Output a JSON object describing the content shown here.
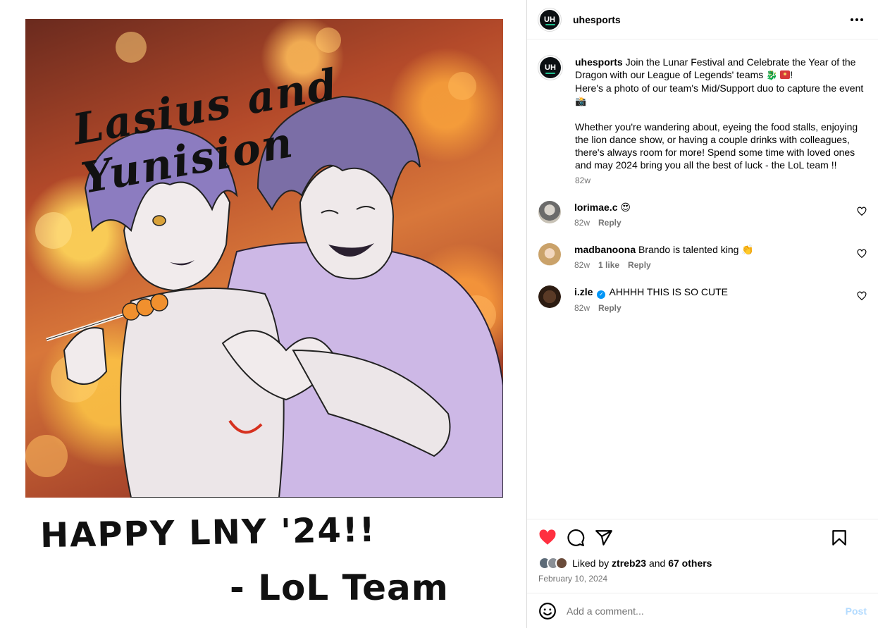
{
  "post": {
    "account": "uhesports",
    "avatar_text": "UH",
    "art": {
      "title": "Lasius and Yunision",
      "greeting": "HAPPY LNY '24!!",
      "signature": "- LoL Team"
    },
    "caption": {
      "username": "uhesports",
      "line1": "Join the Lunar Festival and Celebrate the Year of the Dragon with our League of Legends' teams",
      "emoji1": "🐉",
      "after_emoji": "!",
      "line2": "Here's a photo of our team's Mid/Support duo to capture the event",
      "emoji2": "📸",
      "paragraph2": "Whether you're wandering about, eyeing the food stalls, enjoying the lion dance show, or having a couple drinks with colleagues, there's always room for more! Spend some time with loved ones and may 2024 bring you all the best of luck - the LoL team !!",
      "time": "82w"
    },
    "comments": [
      {
        "username": "lorimae.c",
        "text": "😍",
        "time": "82w",
        "likes": "",
        "reply": "Reply",
        "verified": false
      },
      {
        "username": "madbanoona",
        "text": "Brando is talented king 👏",
        "time": "82w",
        "likes": "1 like",
        "reply": "Reply",
        "verified": false
      },
      {
        "username": "i.zle",
        "text": "AHHHH THIS IS SO CUTE",
        "time": "82w",
        "likes": "",
        "reply": "Reply",
        "verified": true
      }
    ],
    "liked_by_prefix": "Liked by",
    "liked_by_user": "ztreb23",
    "liked_by_and": "and",
    "liked_by_others": "67 others",
    "date": "February 10, 2024",
    "add_comment_placeholder": "Add a comment...",
    "post_label": "Post",
    "colors": {
      "like_red": "#ff3040",
      "link_blue": "#0095f6",
      "post_disabled": "#b3dbff"
    },
    "icons": [
      "more-icon",
      "heart-icon",
      "comment-icon",
      "share-icon",
      "bookmark-icon",
      "emoji-icon",
      "small-heart-icon",
      "verified-icon"
    ]
  }
}
